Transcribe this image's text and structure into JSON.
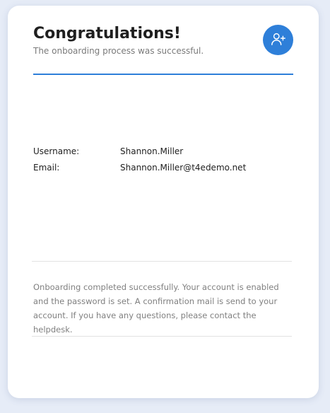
{
  "header": {
    "title": "Congratulations!",
    "subtitle": "The onboarding process was successful.",
    "icon": "user-plus-icon",
    "accent_color": "#2e7fd9"
  },
  "details": {
    "username_label": "Username:",
    "username_value": "Shannon.Miller",
    "email_label": "Email:",
    "email_value": "Shannon.Miller@t4edemo.net"
  },
  "message": {
    "text": "Onboarding completed successfully. Your account is enabled and the password is set. A confirmation mail is send to your account. If you have any questions, please contact the helpdesk."
  }
}
